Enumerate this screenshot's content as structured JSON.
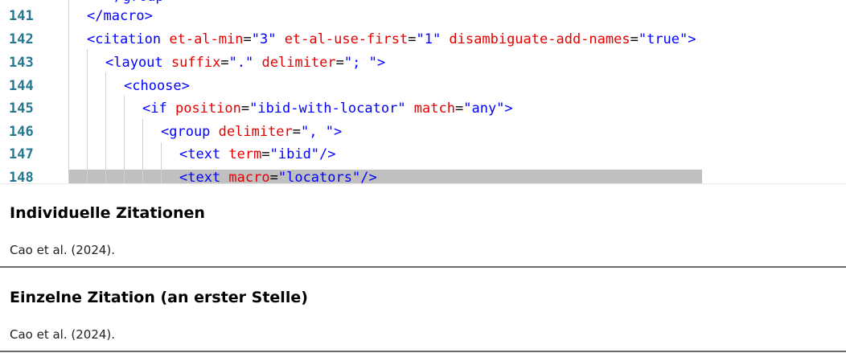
{
  "editor": {
    "lines": [
      {
        "num": "141",
        "tokens": [
          {
            "t": "</macro>",
            "c": "tag"
          }
        ]
      },
      {
        "num": "142",
        "tokens": [
          {
            "t": "<citation ",
            "c": "tag"
          },
          {
            "t": "et-al-min",
            "c": "attr"
          },
          {
            "t": "=",
            "c": "eq"
          },
          {
            "t": "\"3\"",
            "c": "val"
          },
          {
            "t": " et-al-use-first",
            "c": "attr"
          },
          {
            "t": "=",
            "c": "eq"
          },
          {
            "t": "\"1\"",
            "c": "val"
          },
          {
            "t": " disambiguate-add-names",
            "c": "attr"
          },
          {
            "t": "=",
            "c": "eq"
          },
          {
            "t": "\"true\"",
            "c": "val"
          },
          {
            "t": ">",
            "c": "tag"
          }
        ]
      },
      {
        "num": "143",
        "tokens": [
          {
            "t": "<layout ",
            "c": "tag"
          },
          {
            "t": "suffix",
            "c": "attr"
          },
          {
            "t": "=",
            "c": "eq"
          },
          {
            "t": "\".\"",
            "c": "val"
          },
          {
            "t": " delimiter",
            "c": "attr"
          },
          {
            "t": "=",
            "c": "eq"
          },
          {
            "t": "\"; \"",
            "c": "val"
          },
          {
            "t": ">",
            "c": "tag"
          }
        ]
      },
      {
        "num": "144",
        "tokens": [
          {
            "t": "<choose>",
            "c": "tag"
          }
        ]
      },
      {
        "num": "145",
        "tokens": [
          {
            "t": "<if ",
            "c": "tag"
          },
          {
            "t": "position",
            "c": "attr"
          },
          {
            "t": "=",
            "c": "eq"
          },
          {
            "t": "\"ibid-with-locator\"",
            "c": "val"
          },
          {
            "t": " match",
            "c": "attr"
          },
          {
            "t": "=",
            "c": "eq"
          },
          {
            "t": "\"any\"",
            "c": "val"
          },
          {
            "t": ">",
            "c": "tag"
          }
        ]
      },
      {
        "num": "146",
        "tokens": [
          {
            "t": "<group ",
            "c": "tag"
          },
          {
            "t": "delimiter",
            "c": "attr"
          },
          {
            "t": "=",
            "c": "eq"
          },
          {
            "t": "\", \"",
            "c": "val"
          },
          {
            "t": ">",
            "c": "tag"
          }
        ]
      },
      {
        "num": "147",
        "tokens": [
          {
            "t": "<text ",
            "c": "tag"
          },
          {
            "t": "term",
            "c": "attr"
          },
          {
            "t": "=",
            "c": "eq"
          },
          {
            "t": "\"ibid\"",
            "c": "val"
          },
          {
            "t": "/>",
            "c": "tag"
          }
        ]
      },
      {
        "num": "148",
        "tokens": [
          {
            "t": "<text ",
            "c": "tag"
          },
          {
            "t": "macro",
            "c": "attr"
          },
          {
            "t": "=",
            "c": "eq"
          },
          {
            "t": "\"locators\"",
            "c": "val"
          },
          {
            "t": "/>",
            "c": "tag"
          }
        ]
      }
    ]
  },
  "preview": {
    "sections": [
      {
        "title": "Individuelle Zitationen",
        "text": "Cao et al. (2024)."
      },
      {
        "title": "Einzelne Zitation (an erster Stelle)",
        "text": "Cao et al. (2024)."
      }
    ]
  },
  "colors": {
    "tag": "#0000ff",
    "attr": "#e50000",
    "value": "#0000ff",
    "line_number": "#237893",
    "selection": "#c0c0c0"
  }
}
